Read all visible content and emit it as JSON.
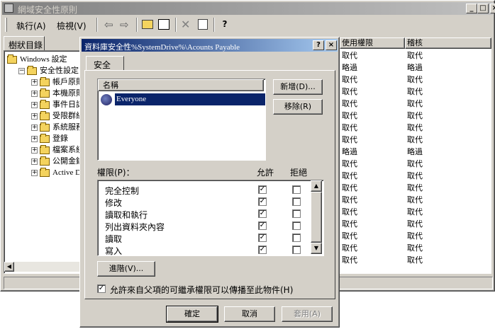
{
  "main_window": {
    "title": "網域安全性原則",
    "menu": {
      "action": "執行(A)",
      "view": "檢視(V)"
    },
    "tree_tab": "樹狀目錄",
    "tree": [
      {
        "label": "Windows 設定",
        "indent": 0
      },
      {
        "label": "安全性設定",
        "indent": 1
      },
      {
        "label": "帳戶原則",
        "indent": 2
      },
      {
        "label": "本機原則",
        "indent": 2
      },
      {
        "label": "事件日誌",
        "indent": 2
      },
      {
        "label": "受限群組",
        "indent": 2
      },
      {
        "label": "系統服務",
        "indent": 2
      },
      {
        "label": "登錄",
        "indent": 2
      },
      {
        "label": "檔案系統",
        "indent": 2
      },
      {
        "label": "公開金鑰",
        "indent": 2
      },
      {
        "label": "Active Dir",
        "indent": 2
      }
    ],
    "columns": {
      "col1": "使用權限",
      "col2": "稽核"
    },
    "rows": [
      [
        "取代",
        "取代"
      ],
      [
        "略過",
        "略過"
      ],
      [
        "取代",
        "取代"
      ],
      [
        "取代",
        "取代"
      ],
      [
        "取代",
        "取代"
      ],
      [
        "取代",
        "取代"
      ],
      [
        "取代",
        "取代"
      ],
      [
        "取代",
        "取代"
      ],
      [
        "略過",
        "略過"
      ],
      [
        "取代",
        "取代"
      ],
      [
        "取代",
        "取代"
      ],
      [
        "取代",
        "取代"
      ],
      [
        "取代",
        "取代"
      ],
      [
        "取代",
        "取代"
      ],
      [
        "取代",
        "取代"
      ],
      [
        "取代",
        "取代"
      ],
      [
        "取代",
        "取代"
      ],
      [
        "取代",
        "取代"
      ]
    ]
  },
  "dialog": {
    "title": "資料庫安全性%SystemDrive%\\Acounts Payable",
    "tab": "安全",
    "name_header": "名稱",
    "users": [
      "Everyone"
    ],
    "add_button": "新增(D)...",
    "remove_button": "移除(R)",
    "permissions_label": "權限(P)：",
    "allow_label": "允許",
    "deny_label": "拒絕",
    "permissions": [
      {
        "name": "完全控制",
        "allow": true,
        "deny": false
      },
      {
        "name": "修改",
        "allow": true,
        "deny": false
      },
      {
        "name": "讀取和執行",
        "allow": true,
        "deny": false
      },
      {
        "name": "列出資料夾內容",
        "allow": true,
        "deny": false
      },
      {
        "name": "讀取",
        "allow": true,
        "deny": false
      },
      {
        "name": "寫入",
        "allow": true,
        "deny": false
      }
    ],
    "advanced_button": "進階(V)...",
    "inherit_label": "允許來自父項的可繼承權限可以傳播至此物件(H)",
    "inherit_checked": true,
    "ok_button": "確定",
    "cancel_button": "取消",
    "apply_button": "套用(A)",
    "check_mark": "✓"
  }
}
